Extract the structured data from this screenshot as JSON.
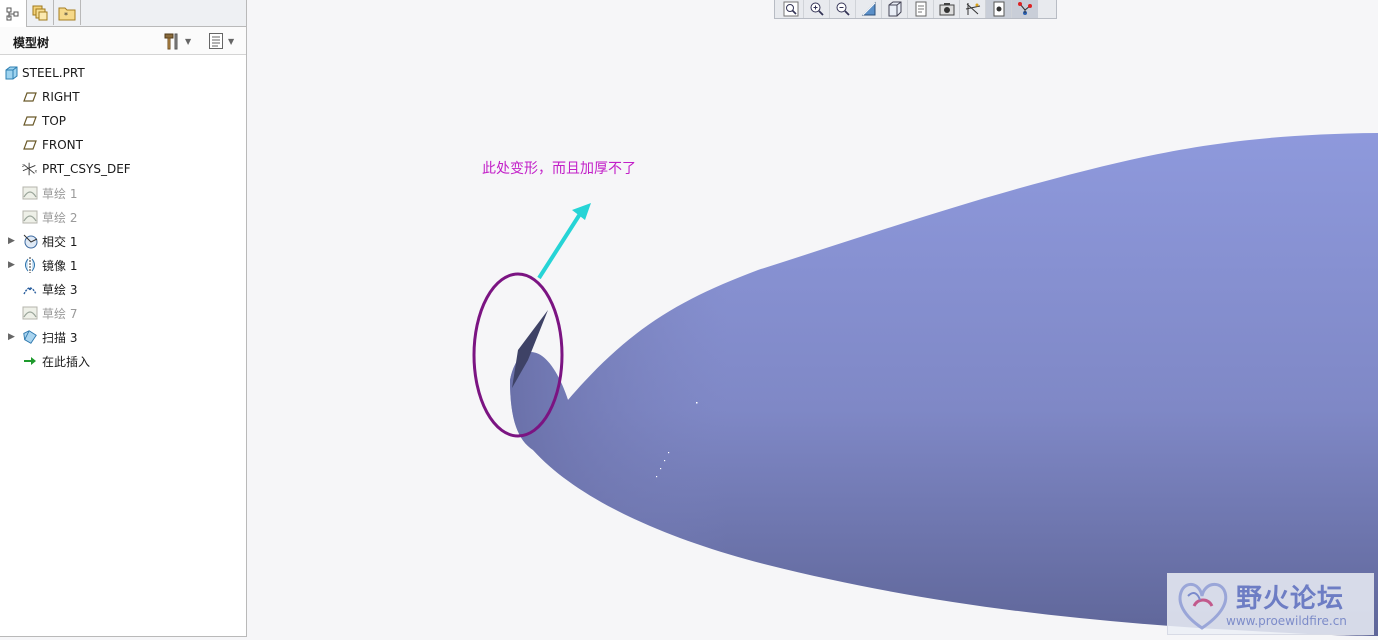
{
  "panel": {
    "title": "模型树",
    "tabs": [
      {
        "icon": "model-tree-icon",
        "active": true
      },
      {
        "icon": "layers-icon",
        "active": false
      },
      {
        "icon": "favorites-folder-icon",
        "active": false
      }
    ],
    "header_tools": [
      "settings-hammer-icon",
      "tree-columns-icon"
    ]
  },
  "tree": {
    "items": [
      {
        "label": "STEEL.PRT",
        "icon": "part-icon",
        "dim": false,
        "expandable": false,
        "indent": 0
      },
      {
        "label": "RIGHT",
        "icon": "datum-plane-icon",
        "dim": false,
        "expandable": false,
        "indent": 1
      },
      {
        "label": "TOP",
        "icon": "datum-plane-icon",
        "dim": false,
        "expandable": false,
        "indent": 1
      },
      {
        "label": "FRONT",
        "icon": "datum-plane-icon",
        "dim": false,
        "expandable": false,
        "indent": 1
      },
      {
        "label": "PRT_CSYS_DEF",
        "icon": "coordinate-system-icon",
        "dim": false,
        "expandable": false,
        "indent": 1
      },
      {
        "label": "草绘 1",
        "icon": "sketch-icon",
        "dim": true,
        "expandable": false,
        "indent": 1
      },
      {
        "label": "草绘 2",
        "icon": "sketch-icon",
        "dim": true,
        "expandable": false,
        "indent": 1
      },
      {
        "label": "相交 1",
        "icon": "intersect-icon",
        "dim": false,
        "expandable": true,
        "indent": 1
      },
      {
        "label": "镜像 1",
        "icon": "mirror-icon",
        "dim": false,
        "expandable": true,
        "indent": 1
      },
      {
        "label": "草绘 3",
        "icon": "sketch-icon",
        "dim": false,
        "expandable": false,
        "indent": 1
      },
      {
        "label": "草绘 7",
        "icon": "sketch-icon",
        "dim": true,
        "expandable": false,
        "indent": 1
      },
      {
        "label": "扫描 3",
        "icon": "sweep-icon",
        "dim": false,
        "expandable": true,
        "indent": 1
      },
      {
        "label": "在此插入",
        "icon": "insert-here-arrow-icon",
        "dim": false,
        "expandable": false,
        "indent": 1
      }
    ]
  },
  "view_toolbar": {
    "buttons": [
      {
        "name": "refit-icon",
        "pressed": false
      },
      {
        "name": "zoom-in-icon",
        "pressed": false
      },
      {
        "name": "zoom-out-icon",
        "pressed": false
      },
      {
        "name": "repaint-icon",
        "pressed": false
      },
      {
        "name": "display-style-icon",
        "pressed": false
      },
      {
        "name": "saved-views-icon",
        "pressed": false
      },
      {
        "name": "view-manager-icon",
        "pressed": false
      },
      {
        "name": "datum-display-icon",
        "pressed": false
      },
      {
        "name": "spin-center-icon",
        "pressed": true
      },
      {
        "name": "annotation-display-icon",
        "pressed": true
      }
    ]
  },
  "annotation": {
    "text": "此处变形，而且加厚不了",
    "text_color": "#c21fc8",
    "circle_color": "#7b1482",
    "arrow_color": "#26d4d6"
  },
  "model": {
    "surface_color": "#8891d0"
  },
  "watermark": {
    "title": "野火论坛",
    "url": "www.proewildfire.cn"
  }
}
